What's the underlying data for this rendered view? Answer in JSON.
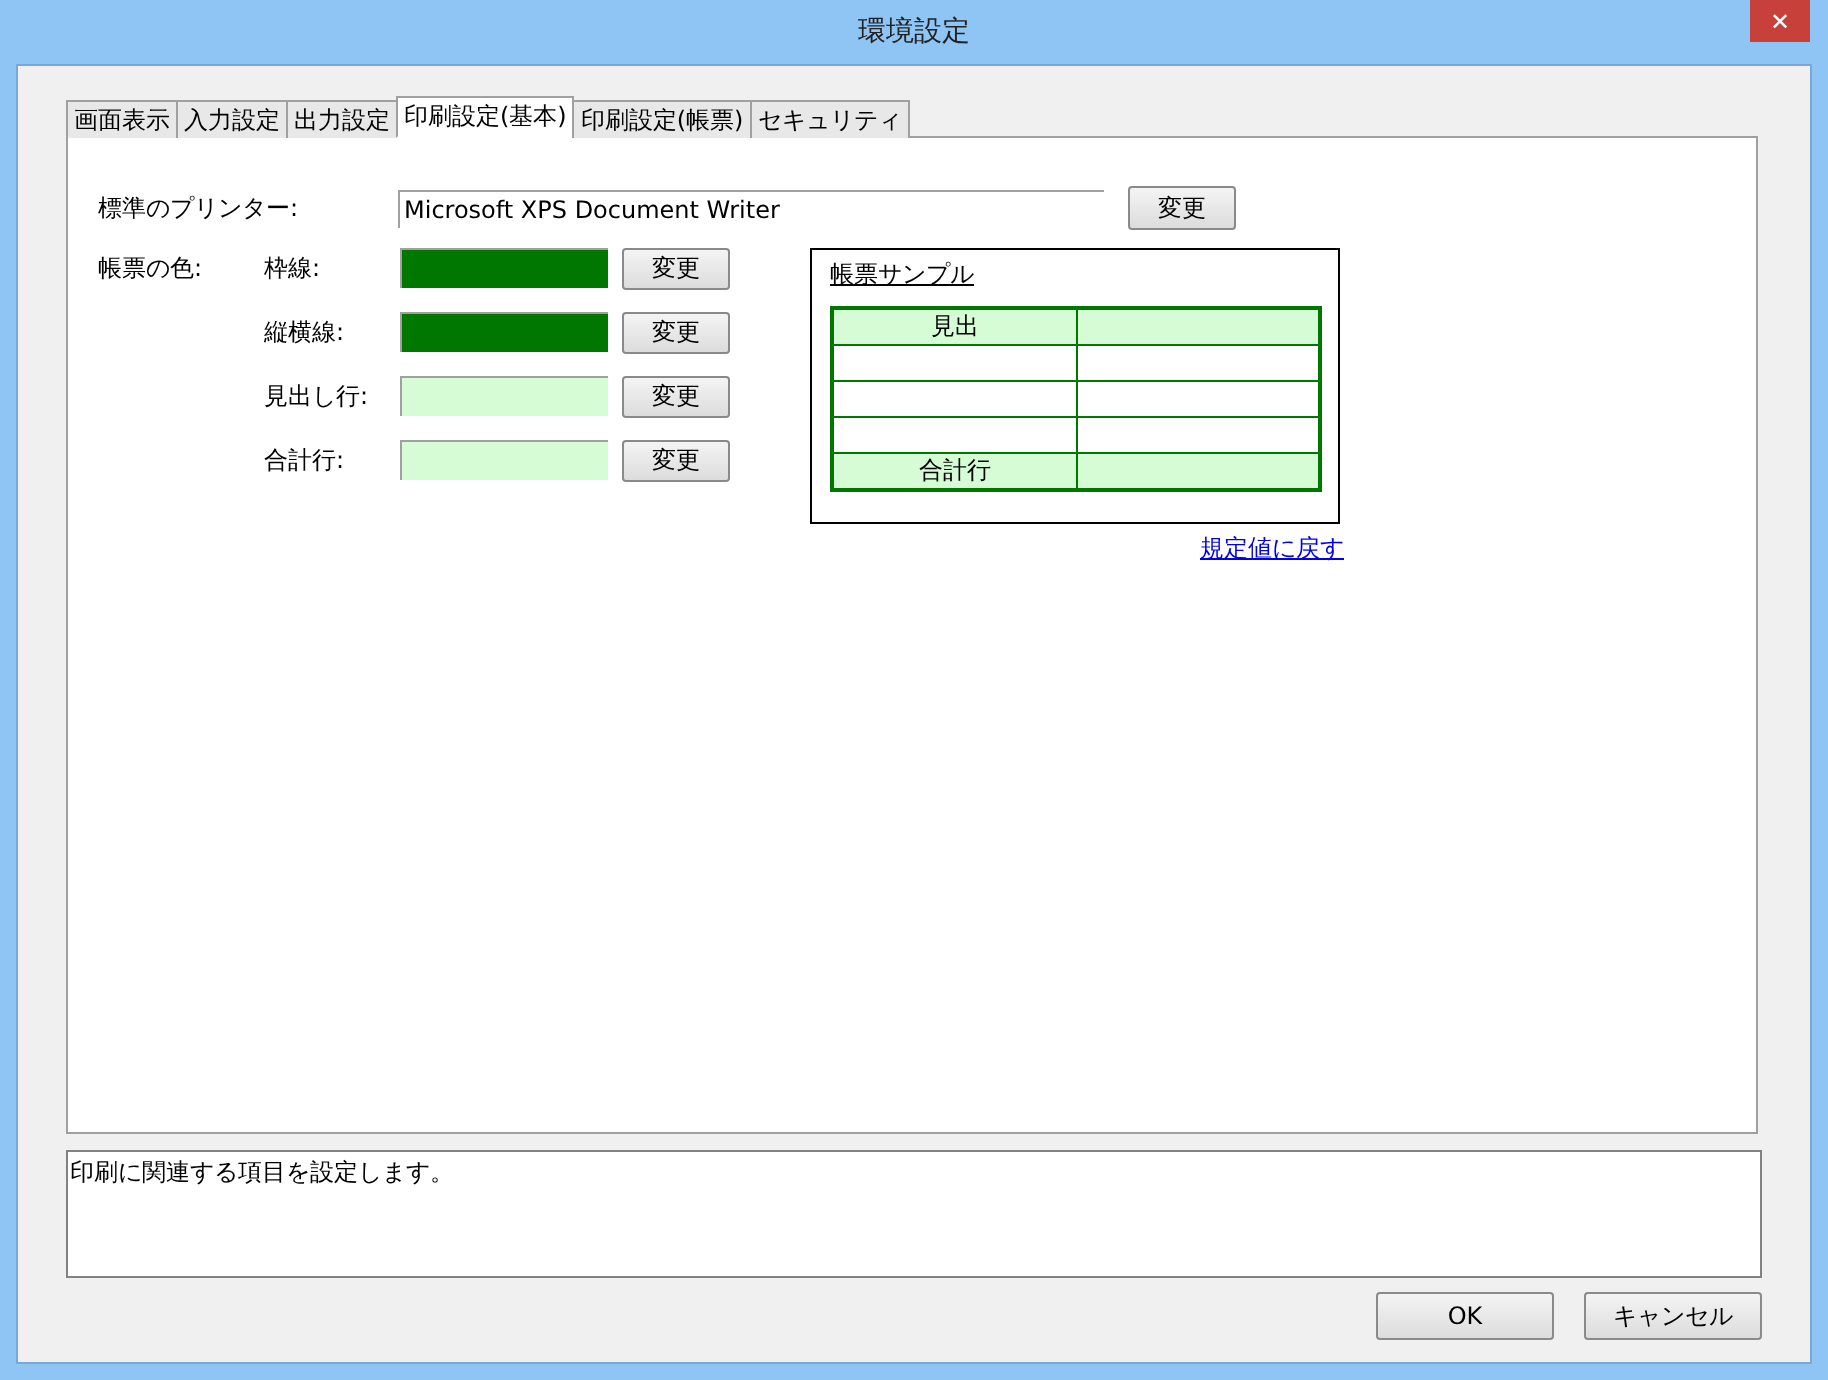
{
  "window": {
    "title": "環境設定",
    "close": "✕"
  },
  "tabs": [
    {
      "label": "画面表示",
      "selected": false
    },
    {
      "label": "入力設定",
      "selected": false
    },
    {
      "label": "出力設定",
      "selected": false
    },
    {
      "label": "印刷設定(基本)",
      "selected": true
    },
    {
      "label": "印刷設定(帳票)",
      "selected": false
    },
    {
      "label": "セキュリティ",
      "selected": false
    }
  ],
  "printer": {
    "label": "標準のプリンター:",
    "value": "Microsoft XPS Document Writer",
    "button": "変更"
  },
  "colors": {
    "label": "帳票の色:",
    "items": [
      {
        "label": "枠線:",
        "color": "#007800",
        "button": "変更"
      },
      {
        "label": "縦横線:",
        "color": "#007800",
        "button": "変更"
      },
      {
        "label": "見出し行:",
        "color": "#d6fcd6",
        "button": "変更"
      },
      {
        "label": "合計行:",
        "color": "#d6fcd6",
        "button": "変更"
      }
    ]
  },
  "sample": {
    "title": "帳票サンプル",
    "header": "見出",
    "total": "合計行"
  },
  "reset_link": "規定値に戻す",
  "description": "印刷に関連する項目を設定します。",
  "buttons": [
    "OK",
    "キャンセル"
  ]
}
